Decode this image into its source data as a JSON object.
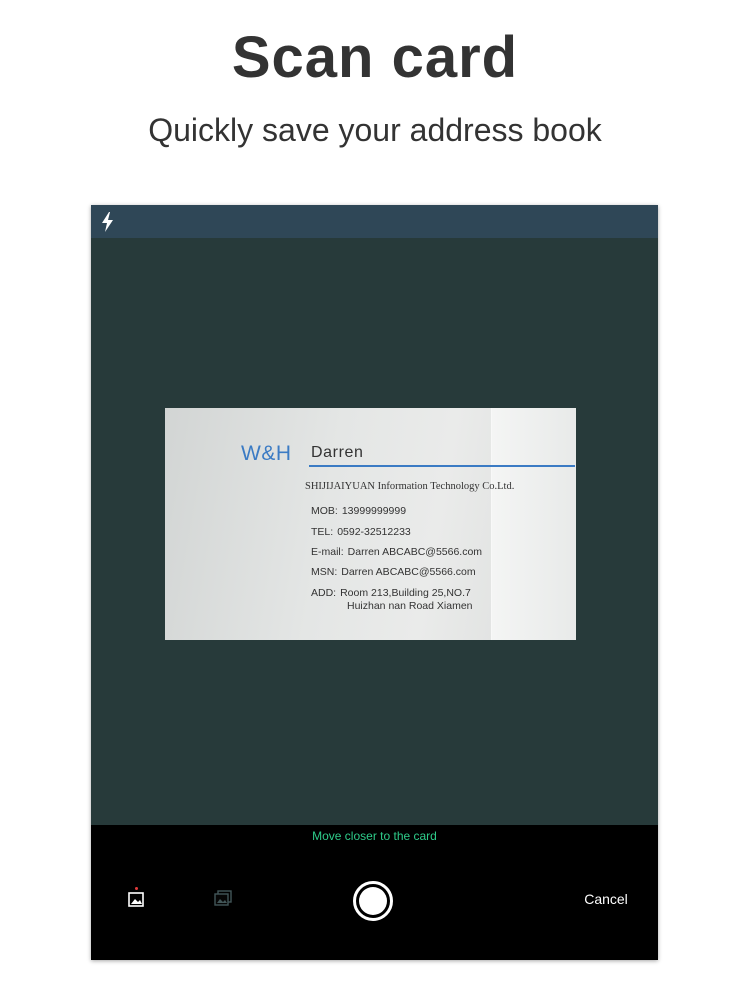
{
  "header": {
    "title": "Scan card",
    "subtitle": "Quickly save your address book"
  },
  "camera": {
    "top_bar": {
      "flash_icon": "lightning-icon"
    },
    "business_card": {
      "logo": "W&H",
      "name": "Darren",
      "company": "SHIJIJAIYUAN Information Technology Co.Ltd.",
      "fields": [
        {
          "label": "MOB:",
          "value": "13999999999"
        },
        {
          "label": "TEL:",
          "value": "0592-32512233"
        },
        {
          "label": "E-mail:",
          "value": "Darren ABCABC@5566.com"
        },
        {
          "label": "MSN:",
          "value": "Darren ABCABC@5566.com"
        },
        {
          "label": "ADD:",
          "value": "Room 213,Building 25,NO.7"
        }
      ],
      "address_line2": "Huizhan nan Road Xiamen"
    },
    "bottom_bar": {
      "hint": "Move closer to the card",
      "gallery_icon": "image-icon",
      "batch_icon": "stacked-images-icon",
      "shutter_icon": "shutter-icon",
      "cancel_label": "Cancel"
    }
  },
  "colors": {
    "hint_green": "#2ecc8a",
    "logo_blue": "#3b7bc4",
    "camera_bg": "#273a3a",
    "top_bar_bg": "#2f4757"
  }
}
